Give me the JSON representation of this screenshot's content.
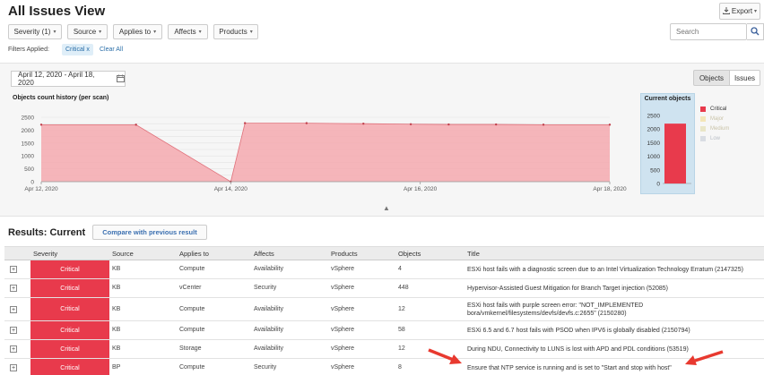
{
  "header": {
    "title": "All Issues View",
    "export_label": "Export",
    "search_placeholder": "Search"
  },
  "filters": {
    "buttons": [
      "Severity (1)",
      "Source",
      "Applies to",
      "Affects",
      "Products"
    ],
    "applied_label": "Filters Applied:",
    "chip_label": "Critical",
    "chip_close": "x",
    "clear_all": "Clear All"
  },
  "panel": {
    "date_range": "April 12, 2020 - April 18, 2020",
    "view_toggle": {
      "objects": "Objects",
      "issues": "Issues",
      "selected": "Objects"
    },
    "collapse_icon": "chevron-up-icon"
  },
  "colors": {
    "critical": "#e83a4c",
    "area_fill": "#f4a9af",
    "major": "#f3e6b8",
    "medium": "#e9e6c8",
    "low": "#d9dde3",
    "current_panel": "#cfe3f0",
    "link": "#2a6ea8"
  },
  "chart_data": [
    {
      "type": "area",
      "title": "Objects count history (per scan)",
      "xlabel": "",
      "ylabel": "",
      "ylim": [
        0,
        2500
      ],
      "yticks": [
        0,
        250,
        500,
        750,
        1000,
        1250,
        1500,
        1750,
        2000,
        2250,
        2500
      ],
      "xtick_labels": [
        "Apr 12, 2020",
        "Apr 14, 2020",
        "Apr 16, 2020",
        "Apr 18, 2020"
      ],
      "x_days": [
        12,
        13,
        14,
        14.15,
        14.8,
        15.4,
        15.9,
        16.3,
        16.8,
        17.3,
        18.0
      ],
      "values": [
        2210,
        2210,
        0,
        2270,
        2270,
        2250,
        2230,
        2220,
        2220,
        2210,
        2210
      ],
      "grid": true
    },
    {
      "type": "bar",
      "title": "Current objects",
      "categories": [
        "Critical"
      ],
      "values": [
        2200
      ],
      "ylim": [
        0,
        2500
      ],
      "yticks": [
        0,
        500,
        1000,
        1500,
        2000,
        2500
      ],
      "legend": [
        "Critical",
        "Major",
        "Medium",
        "Low"
      ],
      "legend_position": "right"
    }
  ],
  "results": {
    "title": "Results: Current",
    "compare_label": "Compare with previous result",
    "columns": [
      "Severity",
      "Source",
      "Applies to",
      "Affects",
      "Products",
      "Objects",
      "Title"
    ],
    "expand_glyph": "+",
    "rows": [
      {
        "severity": "Critical",
        "source": "KB",
        "applies": "Compute",
        "affects": "Availability",
        "products": "vSphere",
        "objects": "4",
        "title": [
          "ESXi host fails with a diagnostic screen due to an Intel Virtualization Technology Erratum (2147325)"
        ]
      },
      {
        "severity": "Critical",
        "source": "KB",
        "applies": "vCenter",
        "affects": "Security",
        "products": "vSphere",
        "objects": "448",
        "title": [
          "Hypervisor-Assisted Guest Mitigation for Branch Target injection (52085)"
        ]
      },
      {
        "severity": "Critical",
        "source": "KB",
        "applies": "Compute",
        "affects": "Availability",
        "products": "vSphere",
        "objects": "12",
        "title": [
          "ESXi host fails with purple screen error: \"NOT_IMPLEMENTED",
          "bora/vmkernel/filesystems/devfs/devfs.c:2655\" (2150280)"
        ]
      },
      {
        "severity": "Critical",
        "source": "KB",
        "applies": "Compute",
        "affects": "Availability",
        "products": "vSphere",
        "objects": "58",
        "title": [
          "ESXi 6.5 and 6.7 host fails with PSOD when IPV6 is globally disabled (2150794)"
        ]
      },
      {
        "severity": "Critical",
        "source": "KB",
        "applies": "Storage",
        "affects": "Availability",
        "products": "vSphere",
        "objects": "12",
        "title": [
          "During NDU, Connectivity to LUNS is lost with APD and PDL conditions (53519)"
        ]
      },
      {
        "severity": "Critical",
        "source": "BP",
        "applies": "Compute",
        "affects": "Security",
        "products": "vSphere",
        "objects": "8",
        "title": [
          "Ensure that NTP service is running and is set to \"Start and stop with host\""
        ]
      }
    ]
  }
}
